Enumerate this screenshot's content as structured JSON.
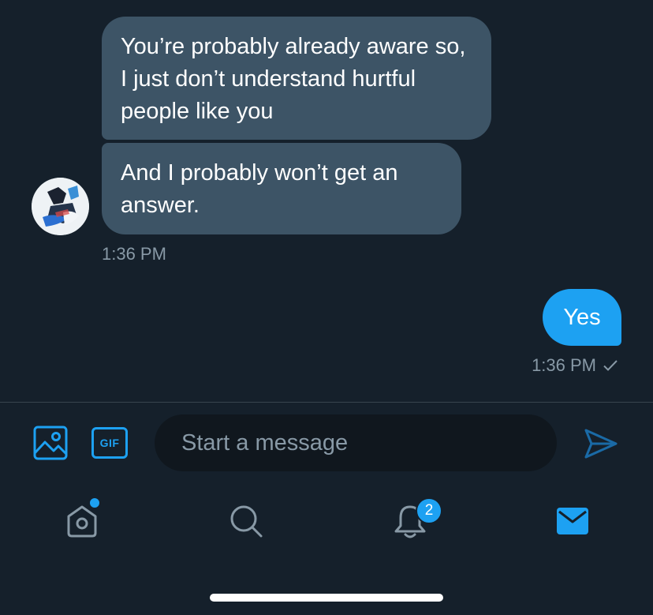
{
  "conversation": {
    "incoming": [
      {
        "text": "You’re probably already aware so, I just don’t understand hurtful people like you"
      },
      {
        "text": "And I probably won’t get an answer."
      }
    ],
    "incoming_time": "1:36 PM",
    "outgoing": {
      "text": "Yes",
      "time": "1:36 PM",
      "status_icon": "checkmark-icon"
    }
  },
  "composer": {
    "placeholder": "Start a message",
    "gif_label": "GIF",
    "icons": [
      "image-icon",
      "gif-icon",
      "send-icon"
    ]
  },
  "bottom_nav": {
    "items": [
      {
        "name": "home",
        "icon": "home-icon",
        "has_dot": true
      },
      {
        "name": "search",
        "icon": "search-icon"
      },
      {
        "name": "notifications",
        "icon": "bell-icon",
        "badge": "2"
      },
      {
        "name": "messages",
        "icon": "mail-icon",
        "active": true
      }
    ]
  },
  "colors": {
    "background": "#15202b",
    "incoming_bubble": "#3d5466",
    "outgoing_bubble": "#1da1f2",
    "accent": "#1da1f2",
    "muted_text": "#8899a6",
    "input_bg": "#10171e"
  }
}
